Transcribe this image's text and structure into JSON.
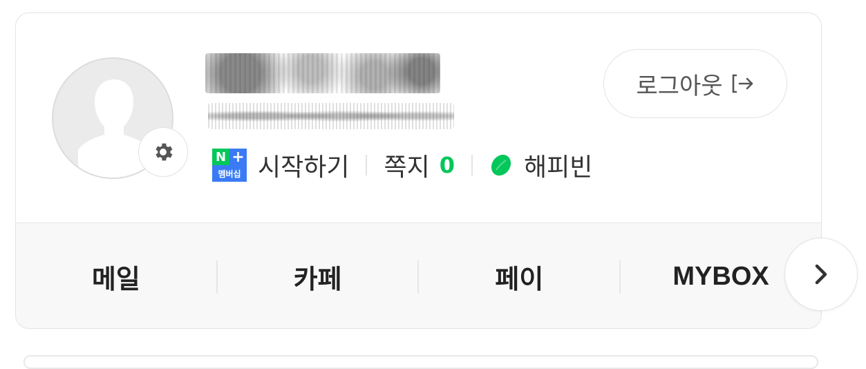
{
  "profile": {
    "status": {
      "membership_badge": {
        "top_left": "N",
        "top_right": "+",
        "bottom": "멤버십"
      },
      "start_label": "시작하기",
      "note_label": "쪽지",
      "note_count": "0",
      "happybean_label": "해피빈"
    },
    "logout_label": "로그아웃"
  },
  "nav": {
    "items": [
      "메일",
      "카페",
      "페이",
      "MYBOX"
    ]
  },
  "icons": {
    "avatar": "person-silhouette-icon",
    "settings": "gear-icon",
    "logout": "logout-arrow-icon",
    "happybean": "bean-icon",
    "next": "chevron-right-icon"
  },
  "colors": {
    "accent_green": "#03c75a",
    "membership_blue": "#3a7bf5"
  }
}
